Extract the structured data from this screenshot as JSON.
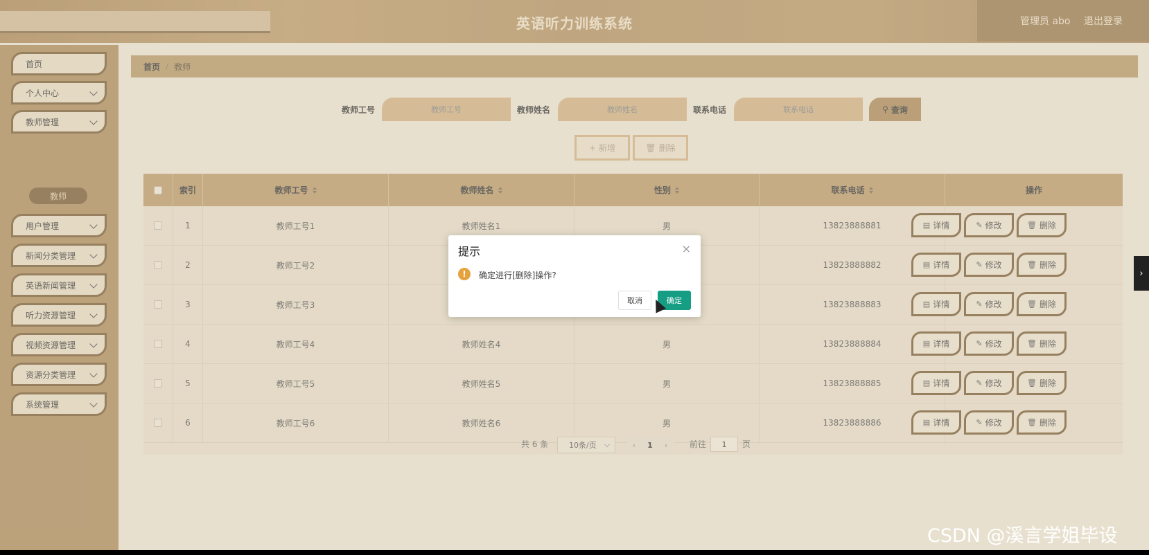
{
  "header": {
    "title": "英语听力训练系统",
    "user": "管理员 abo",
    "logout": "退出登录"
  },
  "sidebar": {
    "items": [
      {
        "label": "首页",
        "expandable": false
      },
      {
        "label": "个人中心",
        "expandable": true
      },
      {
        "label": "教师管理",
        "expandable": true
      },
      {
        "label": "用户管理",
        "expandable": true
      },
      {
        "label": "新闻分类管理",
        "expandable": true
      },
      {
        "label": "英语新闻管理",
        "expandable": true
      },
      {
        "label": "听力资源管理",
        "expandable": true
      },
      {
        "label": "视频资源管理",
        "expandable": true
      },
      {
        "label": "资源分类管理",
        "expandable": true
      },
      {
        "label": "系统管理",
        "expandable": true
      }
    ],
    "active_sub": "教师"
  },
  "breadcrumb": {
    "home": "首页",
    "sep": "/",
    "current": "教师"
  },
  "search": {
    "fields": [
      {
        "label": "教师工号",
        "placeholder": "教师工号"
      },
      {
        "label": "教师姓名",
        "placeholder": "教师姓名"
      },
      {
        "label": "联系电话",
        "placeholder": "联系电话"
      }
    ],
    "button": "查询"
  },
  "toolbar": {
    "add": "新增",
    "delete": "删除"
  },
  "table": {
    "columns": [
      "索引",
      "教师工号",
      "教师姓名",
      "性别",
      "联系电话",
      "操作"
    ],
    "rows": [
      {
        "index": "1",
        "id": "教师工号1",
        "name": "教师姓名1",
        "gender": "男",
        "phone": "13823888881"
      },
      {
        "index": "2",
        "id": "教师工号2",
        "name": "",
        "gender": "",
        "phone": "13823888882"
      },
      {
        "index": "3",
        "id": "教师工号3",
        "name": "",
        "gender": "",
        "phone": "13823888883"
      },
      {
        "index": "4",
        "id": "教师工号4",
        "name": "教师姓名4",
        "gender": "男",
        "phone": "13823888884"
      },
      {
        "index": "5",
        "id": "教师工号5",
        "name": "教师姓名5",
        "gender": "男",
        "phone": "13823888885"
      },
      {
        "index": "6",
        "id": "教师工号6",
        "name": "教师姓名6",
        "gender": "男",
        "phone": "13823888886"
      }
    ],
    "actions": {
      "detail": "详情",
      "edit": "修改",
      "delete": "删除"
    }
  },
  "pagination": {
    "total": "共 6 条",
    "page_size": "10条/页",
    "current_page": "1",
    "goto_label": "前往",
    "goto_value": "1",
    "goto_unit": "页"
  },
  "dialog": {
    "title": "提示",
    "message": "确定进行[删除]操作?",
    "cancel": "取消",
    "confirm": "确定"
  },
  "watermark": "CSDN @溪言学姐毕设",
  "colors": {
    "header": "#a98552",
    "sidebar": "#a37f4b",
    "accent_dark": "#6b4a1f",
    "confirm": "#169e84",
    "warning": "#e6a23c"
  }
}
